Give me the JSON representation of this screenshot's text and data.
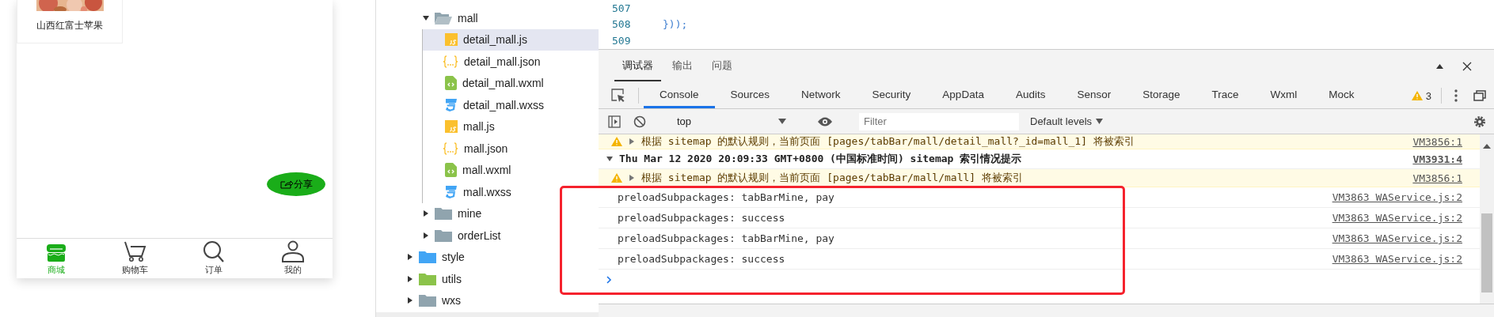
{
  "simulator": {
    "product": {
      "name": "山西红富士苹果"
    },
    "share_button": {
      "label": "分享"
    },
    "tab_bar": [
      {
        "label": "商城",
        "kind": "store",
        "selected": true
      },
      {
        "label": "购物车",
        "kind": "cart",
        "selected": false
      },
      {
        "label": "订单",
        "kind": "search",
        "selected": false
      },
      {
        "label": "我的",
        "kind": "person",
        "selected": false
      }
    ]
  },
  "file_tree": {
    "nested_items": [
      {
        "name": "mall",
        "color": "#90a4ae",
        "expanded": true,
        "children": [
          {
            "name": "detail_mall.js",
            "kind": "js",
            "selected": true
          },
          {
            "name": "detail_mall.json",
            "kind": "json",
            "selected": false
          },
          {
            "name": "detail_mall.wxml",
            "kind": "wxml",
            "selected": false
          },
          {
            "name": "detail_mall.wxss",
            "kind": "wxss",
            "selected": false
          },
          {
            "name": "mall.js",
            "kind": "js",
            "selected": false
          },
          {
            "name": "mall.json",
            "kind": "json",
            "selected": false
          },
          {
            "name": "mall.wxml",
            "kind": "wxml",
            "selected": false
          },
          {
            "name": "mall.wxss",
            "kind": "wxss",
            "selected": false
          }
        ]
      },
      {
        "name": "mine",
        "color": "#90a4ae",
        "expanded": false
      },
      {
        "name": "orderList",
        "color": "#90a4ae",
        "expanded": false
      }
    ],
    "items": [
      {
        "name": "style",
        "color": "#42a5f5",
        "expanded": false
      },
      {
        "name": "utils",
        "color": "#8bc34a",
        "expanded": false
      },
      {
        "name": "wxs",
        "color": "#90a4ae",
        "expanded": false
      }
    ]
  },
  "editor": {
    "lines": [
      {
        "number": "507"
      },
      {
        "number": "508",
        "code": "}));"
      },
      {
        "number": "509"
      }
    ]
  },
  "devtools": {
    "panel_tabs": [
      {
        "label": "调试器",
        "selected": true
      },
      {
        "label": "输出",
        "selected": false
      },
      {
        "label": "问题",
        "selected": false
      }
    ],
    "tabs": [
      {
        "label": "Console",
        "selected": true
      },
      {
        "label": "Sources",
        "selected": false
      },
      {
        "label": "Network",
        "selected": false
      },
      {
        "label": "Security",
        "selected": false
      },
      {
        "label": "AppData",
        "selected": false
      },
      {
        "label": "Audits",
        "selected": false
      },
      {
        "label": "Sensor",
        "selected": false
      },
      {
        "label": "Storage",
        "selected": false
      },
      {
        "label": "Trace",
        "selected": false
      },
      {
        "label": "Wxml",
        "selected": false
      },
      {
        "label": "Mock",
        "selected": false
      }
    ],
    "warning_count": "3",
    "toolbar": {
      "context": "top",
      "filter_placeholder": "Filter",
      "levels": "Default levels"
    },
    "messages": [
      {
        "kind": "warning",
        "expanded": false,
        "text": "根据 sitemap 的默认规则，当前页面 [pages/tabBar/mall/detail_mall?_id=mall_1] 将被索引",
        "source": "VM3856:1"
      },
      {
        "kind": "group",
        "expanded": true,
        "text": "Thu Mar 12 2020 20:09:33 GMT+0800 (中国标准时间) sitemap 索引情况提示",
        "source": "VM3931:4"
      },
      {
        "kind": "warning",
        "expanded": false,
        "text": "根据 sitemap 的默认规则，当前页面 [pages/tabBar/mall/mall] 将被索引",
        "source": "VM3856:1"
      },
      {
        "kind": "log",
        "text": "preloadSubpackages: tabBarMine, pay",
        "source": "VM3863 WAService.js:2"
      },
      {
        "kind": "log",
        "text": "preloadSubpackages: success",
        "source": "VM3863 WAService.js:2"
      },
      {
        "kind": "log",
        "text": "preloadSubpackages: tabBarMine, pay",
        "source": "VM3863 WAService.js:2"
      },
      {
        "kind": "log",
        "text": "preloadSubpackages: success",
        "source": "VM3863 WAService.js:2"
      }
    ]
  }
}
